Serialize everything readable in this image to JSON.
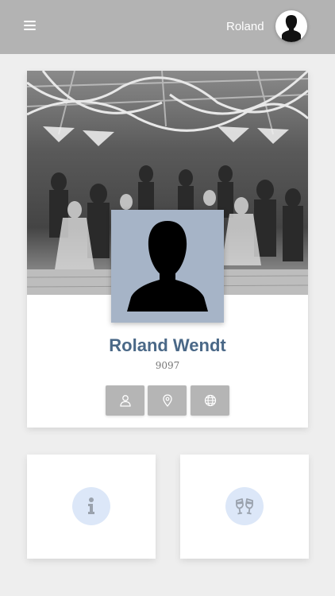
{
  "header": {
    "user_name": "Roland",
    "menu_icon": "hamburger-menu-icon",
    "avatar_icon": "user-silhouette-icon"
  },
  "profile": {
    "full_name": "Roland Wendt",
    "user_id": "9097",
    "cover_image": "vintage-dance-hall-photo",
    "photo_icon": "user-silhouette-icon"
  },
  "actions": [
    {
      "icon": "person-icon"
    },
    {
      "icon": "location-pin-icon"
    },
    {
      "icon": "globe-icon"
    }
  ],
  "tiles": [
    {
      "icon": "info-icon"
    },
    {
      "icon": "toast-glasses-icon"
    }
  ],
  "colors": {
    "header_bg": "#b3b3b3",
    "page_bg": "#eeeeee",
    "name_color": "#4a6887",
    "photo_bg": "#a6b4c7",
    "button_bg": "#b5b5b5",
    "tile_icon_bg": "#dce7f8"
  }
}
